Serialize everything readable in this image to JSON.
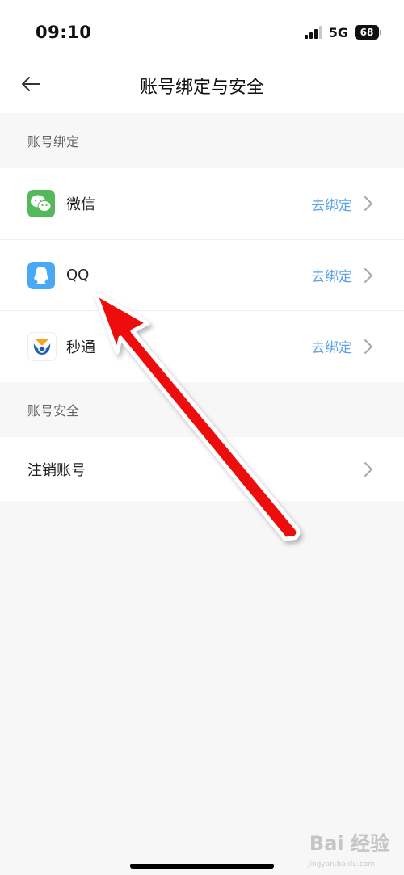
{
  "status_bar": {
    "time": "09:10",
    "network": "5G",
    "battery": "68"
  },
  "header": {
    "title": "账号绑定与安全"
  },
  "sections": {
    "binding_title": "账号绑定",
    "security_title": "账号安全"
  },
  "bindings": [
    {
      "name": "微信",
      "action": "去绑定",
      "icon": "wechat-icon"
    },
    {
      "name": "QQ",
      "action": "去绑定",
      "icon": "qq-icon"
    },
    {
      "name": "秒通",
      "action": "去绑定",
      "icon": "miaotong-icon"
    }
  ],
  "security": {
    "deactivate_label": "注销账号"
  },
  "watermark": {
    "brand": "Bai 经验",
    "url": "jingyan.baidu.com"
  },
  "colors": {
    "accent_link": "#5aa3e6",
    "wechat": "#53b95b",
    "qq": "#4aa9f4",
    "arrow": "#ee1111"
  }
}
